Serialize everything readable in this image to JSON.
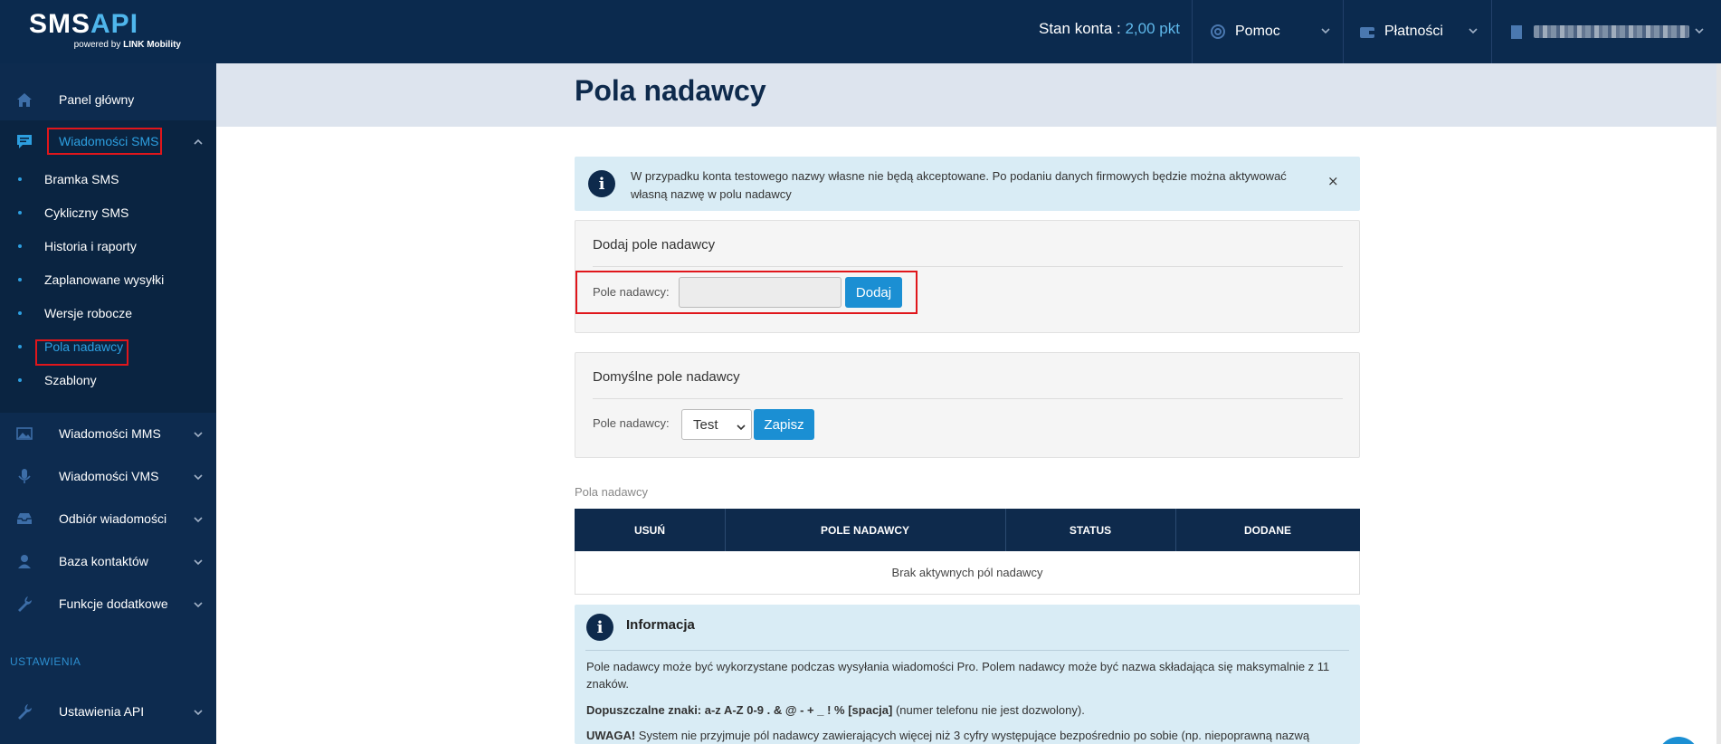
{
  "brand": {
    "logo_main": "SMS",
    "logo_accent": "API",
    "logo_powered": "powered by",
    "logo_company": "LINK Mobility"
  },
  "topbar": {
    "balance_label": "Stan konta :",
    "balance_value": "2,00 pkt",
    "help_label": "Pomoc",
    "payments_label": "Płatności"
  },
  "sidebar": {
    "items": [
      {
        "label": "Panel główny"
      },
      {
        "label": "Wiadomości SMS"
      },
      {
        "label": "Wiadomości MMS"
      },
      {
        "label": "Wiadomości VMS"
      },
      {
        "label": "Odbiór wiadomości"
      },
      {
        "label": "Baza kontaktów"
      },
      {
        "label": "Funkcje dodatkowe"
      },
      {
        "label": "Ustawienia API"
      }
    ],
    "sms_sub": [
      {
        "label": "Bramka SMS"
      },
      {
        "label": "Cykliczny SMS"
      },
      {
        "label": "Historia i raporty"
      },
      {
        "label": "Zaplanowane wysyłki"
      },
      {
        "label": "Wersje robocze"
      },
      {
        "label": "Pola nadawcy"
      },
      {
        "label": "Szablony"
      }
    ],
    "section_settings": "USTAWIENIA"
  },
  "page": {
    "title": "Pola nadawcy",
    "alert_text": "W przypadku konta testowego nazwy własne nie będą akceptowane. Po podaniu danych firmowych będzie można aktywować własną nazwę w polu nadawcy",
    "alert_close": "×"
  },
  "add_panel": {
    "title": "Dodaj pole nadawcy",
    "field_label": "Pole nadawcy:",
    "input_value": "",
    "button": "Dodaj"
  },
  "default_panel": {
    "title": "Domyślne pole nadawcy",
    "field_label": "Pole nadawcy:",
    "selected": "Test",
    "button": "Zapisz"
  },
  "table": {
    "caption": "Pola nadawcy",
    "columns": [
      "USUŃ",
      "POLE NADAWCY",
      "STATUS",
      "DODANE"
    ],
    "empty_text": "Brak aktywnych pól nadawcy"
  },
  "info": {
    "title": "Informacja",
    "p1": "Pole nadawcy może być wykorzystane podczas wysyłania wiadomości Pro. Polem nadawcy może być nazwa składająca się maksymalnie z 11 znaków.",
    "p2_bold": "Dopuszczalne znaki: a-z A-Z 0-9 . & @ - + _ ! % [spacja]",
    "p2_rest": " (numer telefonu nie jest dozwolony).",
    "p3_bold": "UWAGA!",
    "p3_rest": " System nie przyjmuje pól nadawcy zawierających więcej niż 3 cyfry występujące bezpośrednio po sobie (np. niepoprawną nazwą"
  },
  "colors": {
    "navy": "#0b2a4e",
    "accent": "#2d9fe0",
    "button": "#1b8fd3",
    "highlight_red": "#e0161b",
    "info_bg": "#d9ecf5"
  }
}
